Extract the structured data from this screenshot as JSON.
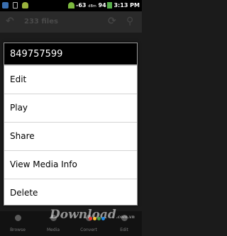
{
  "statusbar": {
    "signal_dbm": "-63",
    "dbm_unit": "dBm",
    "battery": "94",
    "time": "3:13 PM"
  },
  "toolbar": {
    "title": "233 files",
    "back_icon": "back-arrow-icon",
    "refresh_icon": "refresh-icon",
    "search_icon": "search-icon"
  },
  "dialog": {
    "title": "849757599",
    "items": [
      {
        "label": "Edit"
      },
      {
        "label": "Play"
      },
      {
        "label": "Share"
      },
      {
        "label": "View Media Info"
      },
      {
        "label": "Delete"
      }
    ]
  },
  "tabs": [
    {
      "label": "Browse",
      "icon": "folder-icon",
      "color": "#5a5a5a"
    },
    {
      "label": "Media",
      "icon": "media-icon",
      "color": "#5a5a5a"
    },
    {
      "label": "Convert",
      "icon": "convert-icon",
      "color": "#5a5a5a"
    },
    {
      "label": "Edit",
      "icon": "edit-icon",
      "color": "#5a5a5a"
    }
  ],
  "watermark": {
    "text": "Download",
    "tld": ".com.vn",
    "dot_colors": [
      "#e53935",
      "#fbc02d",
      "#43a047",
      "#1e88e5"
    ]
  },
  "colors": {
    "dialog_bg": "#ffffff",
    "dialog_header": "#000000",
    "wifi": "#7cb93f",
    "battery": "#58b04b"
  }
}
